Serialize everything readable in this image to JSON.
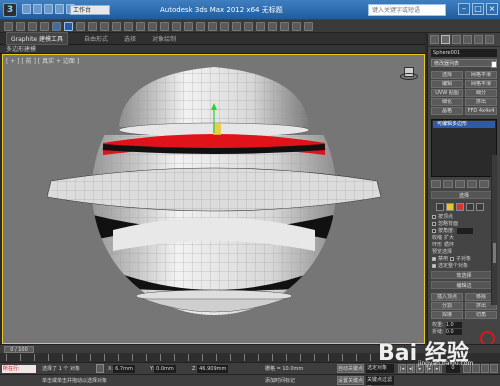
{
  "titlebar": {
    "workspace": "工作台",
    "title": "Autodesk 3ds Max 2012 x64   无标题",
    "search_placeholder": "键入关键字或短语"
  },
  "ribbon": {
    "tabs": [
      "Graphite 建模工具",
      "自由形式",
      "选择",
      "对象绘制"
    ],
    "sub_label": "多边形建模"
  },
  "viewport": {
    "label": "[ + ] [ 前 ] [ 真实 + 边面 ]"
  },
  "command_panel": {
    "object_name": "Sphere001",
    "modifier_list": "修改器列表",
    "buttons": [
      "选择",
      "网格平滑",
      "编辑",
      "网格平滑",
      "UVW 贴图",
      "细分",
      "细化",
      "挤出",
      "晶格",
      "FFD 4x4x4"
    ],
    "stack_item": "可编辑多边形",
    "selection_rollout": "选择",
    "options": [
      "按顶点",
      "忽略背面",
      "按角度:",
      "收缩",
      "扩大",
      "环形",
      "循环",
      "预览选择",
      "禁用",
      "子对象",
      "多个",
      "选定整个对象"
    ],
    "angle_value": "45.0",
    "soft_selection": "软选择",
    "edit_edges_rollout": "编辑边",
    "edge_buttons": [
      "插入顶点",
      "移除",
      "分割",
      "挤出",
      "焊接",
      "切角",
      "目标焊接",
      "桥",
      "连接"
    ],
    "weight_label": "权重:",
    "weight_value": "1.0",
    "crease_label": "折缝:",
    "crease_value": "0.0"
  },
  "timeline": {
    "slider": "0 / 100"
  },
  "status": {
    "script_label": "所在行:",
    "selected_text": "选择了 1 个 对象",
    "hint_text": "单击或单击并拖动以选择对象",
    "x_label": "X:",
    "x_value": "6.7mm",
    "y_label": "Y:",
    "y_value": "0.0mm",
    "z_label": "Z:",
    "z_value": "46.909mm",
    "grid_label": "栅格 = 10.0mm",
    "add_time_tag": "添加时间标记",
    "auto_key": "自动关键点",
    "set_key": "设置关键点",
    "selected_option": "选定对象",
    "key_filters": "关键点过滤器...",
    "frame": "0"
  },
  "watermark": {
    "text": "Bai 经验",
    "sub": "jingyan.baidu.com"
  },
  "colors": {
    "viewport_bg": "#767676",
    "active_border": "#e7c72a",
    "selection_red": "#e0121a",
    "stack_blue": "#2f5aa8"
  }
}
